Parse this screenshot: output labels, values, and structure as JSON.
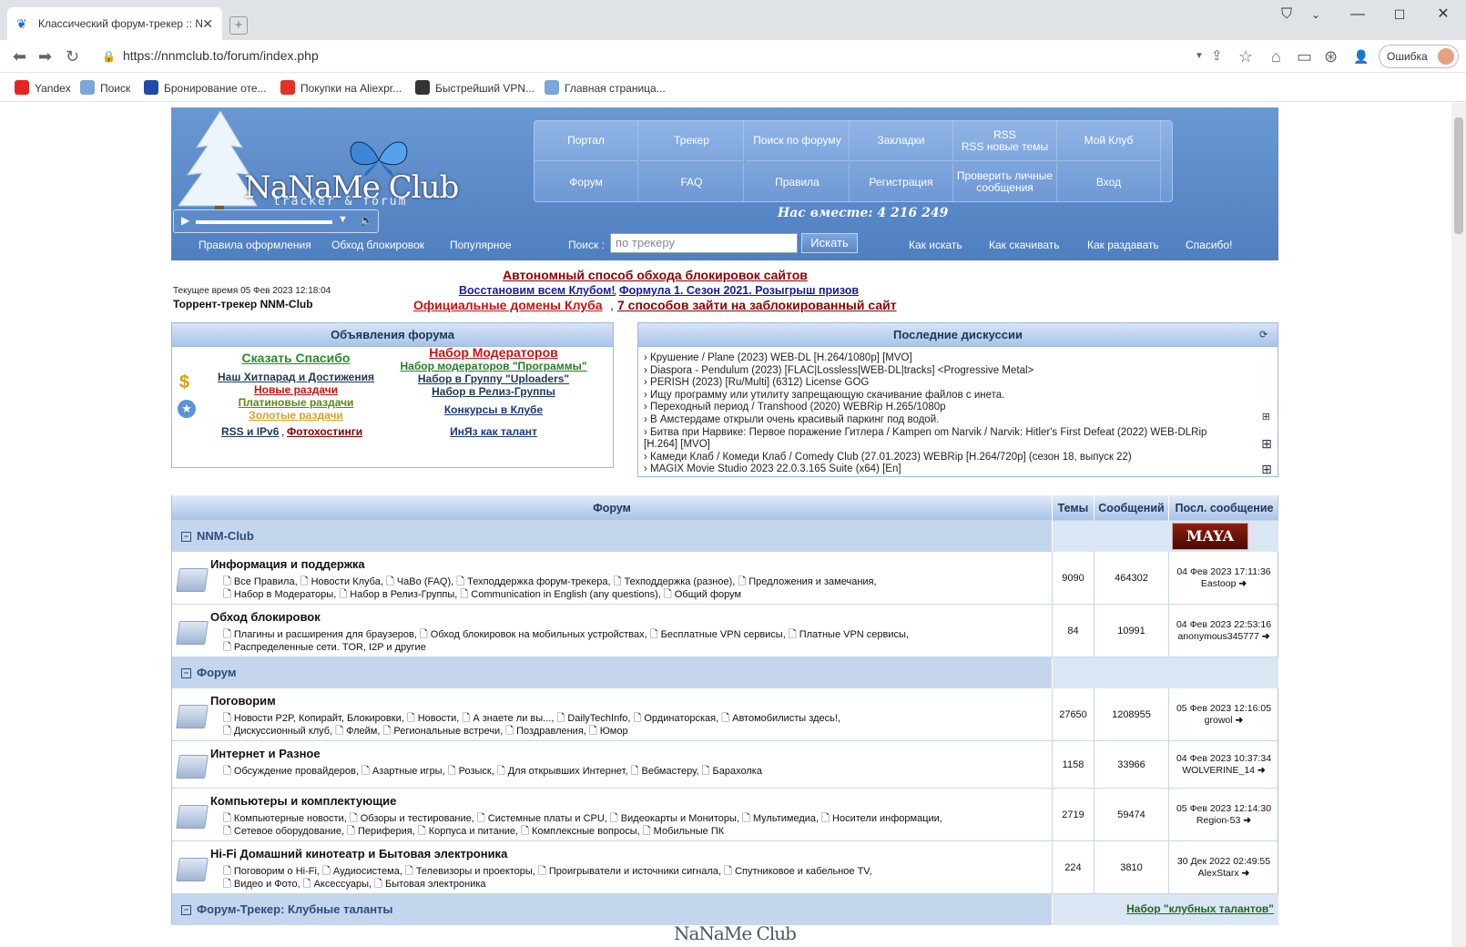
{
  "browser": {
    "tab_title": "Классический форум-трекер :: N",
    "url": "https://nnmclub.to/forum/index.php",
    "error_label": "Ошибка",
    "bookmarks": [
      {
        "label": "Yandex",
        "icon": "yandex-icon",
        "color": "#e52620"
      },
      {
        "label": "Поиск",
        "icon": "globe-icon",
        "color": "#7aa6d8"
      },
      {
        "label": "Бронирование оте...",
        "icon": "booking-icon",
        "color": "#1f4aa8"
      },
      {
        "label": "Покупки на Aliexpr...",
        "icon": "aliexpress-icon",
        "color": "#e43225"
      },
      {
        "label": "Быстрейший VPN...",
        "icon": "vpn-icon",
        "color": "#333333"
      },
      {
        "label": "Главная страница...",
        "icon": "globe-icon",
        "color": "#7aa6d8"
      }
    ]
  },
  "header": {
    "logo": "NaNaMe Club",
    "logo_sub": "tracker & forum",
    "together": "Нас вместе: 4 216 249",
    "nav": [
      [
        "Портал",
        "Трекер",
        "Поиск по форуму",
        "Закладки",
        "RSS\nRSS новые темы",
        "Мой Клуб"
      ],
      [
        "Форум",
        "FAQ",
        "Правила",
        "Регистрация",
        "Проверить личные сообщения",
        "Вход"
      ]
    ],
    "subnav_left": [
      "Правила оформления",
      "Обход блокировок",
      "Популярное"
    ],
    "search_label": "Поиск :",
    "search_placeholder": "по трекеру",
    "search_button": "Искать",
    "subnav_right": [
      "Как искать",
      "Как скачивать",
      "Как раздавать",
      "Спасибо!"
    ]
  },
  "announce": {
    "line1": "Автономный способ обхода блокировок сайтов",
    "line2a": "Восстановим всем Клубом!",
    "line2b": "Формула 1. Сезон 2021. Розыгрыш призов",
    "line3a": "Официальные домены Клуба",
    "line3b": "7 способов зайти на заблокированный сайт",
    "time": "Текущее время 05 Фев 2023 12:18:04",
    "tracker": "Торрент-трекер NNM-Club"
  },
  "forum_ads": {
    "title": "Объявления форума",
    "left": [
      {
        "t": "Сказать Спасибо",
        "color": "#2a8a2a",
        "size": "14px"
      },
      {
        "t": "Наш Хитпарад и Достижения",
        "color": "#1d3858",
        "size": "12px"
      },
      {
        "t": "Новые раздачи",
        "color": "#cc1111",
        "size": "12px"
      },
      {
        "t": "Платиновые раздачи",
        "color": "#5a8a10",
        "size": "12px"
      },
      {
        "t": "Золотые раздачи",
        "color": "#e0a020",
        "size": "12px"
      }
    ],
    "left_last_a": "RSS и IPv6",
    "left_last_b": "Фотохостинги",
    "right": [
      {
        "t": "Набор Модераторов",
        "color": "#cc1111",
        "size": "14px"
      },
      {
        "t": "Набор модераторов \"Программы\"",
        "color": "#2a7a2a",
        "size": "12px"
      },
      {
        "t": "Набор в Группу \"Uploaders\"",
        "color": "#1d3858",
        "size": "12px"
      },
      {
        "t": "Набор в Релиз-Группы",
        "color": "#1d3858",
        "size": "12px"
      },
      {
        "t": "Конкурсы в Клубе",
        "color": "#1d3878",
        "size": "12px"
      },
      {
        "t": "ИнЯз как талант",
        "color": "#1d3878",
        "size": "12px"
      }
    ]
  },
  "discussions": {
    "title": "Последние дискуссии",
    "items": [
      "› Крушение / Plane (2023) WEB-DL [H.264/1080p] [MVO]",
      "› Diaspora - Pendulum (2023) [FLAC|Lossless|WEB-DL|tracks] <Progressive Metal>",
      "› PERISH (2023) [Ru/Multi] (6312) License GOG",
      "› Ищу программу или утилиту запрещающую скачивание файлов с инета.",
      "› Переходный период / Transhood (2020) WEBRip H.265/1080p",
      "› В Амстердаме открыли очень красивый паркинг под водой.",
      "› Битва при Нарвике: Первое поражение Гитлера / Kampen om Narvik / Narvik: Hitler's First Defeat (2022) WEB-DLRip",
      "  [H.264] [MVO]",
      "› Камеди Клаб / Комеди Клаб / Comedy Club (27.01.2023) WEBRip [H.264/720p] (сезон 18, выпуск 22)",
      "› MAGIX Movie Studio 2023 22.0.3.165 Suite (x64) [En]"
    ]
  },
  "table": {
    "headers": [
      "Форум",
      "Темы",
      "Сообщений",
      "Посл. сообщение"
    ],
    "categories": [
      {
        "title": "NNM-Club",
        "banner": "maya",
        "forums": [
          {
            "name": "Информация и поддержка",
            "subs": [
              "Все Правила, 🗋 Новости Клуба, 🗋 ЧаВо (FAQ), 🗋 Техподдержка форум-трекера, 🗋 Техподдержка (разное), 🗋 Предложения и замечания,",
              "Набор в Модераторы, 🗋 Набор в Релиз-Группы, 🗋 Communication in English (any questions), 🗋 Общий форум"
            ],
            "topics": "9090",
            "posts": "464302",
            "last_date": "04 Фев 2023 17:11:36",
            "last_user": "Eastoop"
          },
          {
            "name": "Обход блокировок",
            "subs": [
              "Плагины и расширения для браузеров, 🗋 Обход блокировок на мобильных устройствах, 🗋 Бесплатные VPN сервисы, 🗋 Платные VPN сервисы,",
              "Распределенные сети. TOR, I2P и другие"
            ],
            "topics": "84",
            "posts": "10991",
            "last_date": "04 Фев 2023 22:53:16",
            "last_user": "anonymous345777"
          }
        ]
      },
      {
        "title": "Форум",
        "banner": "",
        "forums": [
          {
            "name": "Поговорим",
            "subs": [
              "Новости P2P, Копирайт, Блокировки, 🗋 Новости, 🗋 А знаете ли вы..., 🗋 DailyTechInfo, 🗋 Ординаторская, 🗋 Автомобилисты здесь!,",
              "Дискуссионный клуб, 🗋 Флейм, 🗋 Региональные встречи, 🗋 Поздравления, 🗋 Юмор"
            ],
            "topics": "27650",
            "posts": "1208955",
            "last_date": "05 Фев 2023 12:16:05",
            "last_user": "growol"
          },
          {
            "name": "Интернет и Разное",
            "subs": [
              "Обсуждение провайдеров, 🗋 Азартные игры, 🗋 Розыск, 🗋 Для открывших Интернет, 🗋 Вебмастеру, 🗋 Барахолка"
            ],
            "topics": "1158",
            "posts": "33966",
            "last_date": "04 Фев 2023 10:37:34",
            "last_user": "WOLVERINE_14"
          },
          {
            "name": "Компьютеры и комплектующие",
            "subs": [
              "Компьютерные новости, 🗋 Обзоры и тестирование, 🗋 Системные платы и CPU, 🗋 Видеокарты и Мониторы, 🗋 Мультимедиа, 🗋 Носители информации,",
              "Сетевое оборудование, 🗋 Периферия, 🗋 Корпуса и питание, 🗋 Комплексные вопросы, 🗋 Мобильные ПК"
            ],
            "topics": "2719",
            "posts": "59474",
            "last_date": "05 Фев 2023 12:14:30",
            "last_user": "Region-53"
          },
          {
            "name": "Hi-Fi Домашний кинотеатр и Бытовая электроника",
            "subs": [
              "Поговорим о Hi-Fi, 🗋 Аудиосистема, 🗋 Телевизоры и проекторы, 🗋 Проигрыватели и источники сигнала, 🗋 Спутниковое и кабельное TV,",
              "Видео и Фото, 🗋 Аксессуары, 🗋 Бытовая электроника"
            ],
            "topics": "224",
            "posts": "3810",
            "last_date": "30 Дек 2022 02:49:55",
            "last_user": "AlexStarx"
          }
        ]
      },
      {
        "title": "Форум-Трекер: Клубные таланты",
        "link": "Набор \"клубных талантов\"",
        "forums": []
      }
    ]
  },
  "watermark": "NaNaMe Club"
}
